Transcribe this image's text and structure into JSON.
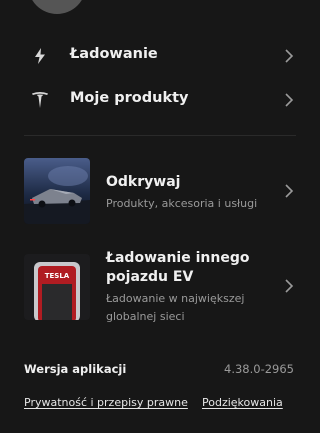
{
  "menu": {
    "charging": {
      "label": "Ładowanie",
      "icon": "bolt-icon"
    },
    "products": {
      "label": "Moje produkty",
      "icon": "tesla-logo-icon"
    }
  },
  "cards": {
    "discover": {
      "title": "Odkrywaj",
      "subtitle": "Produkty, akcesoria i usługi"
    },
    "other_ev": {
      "title_line1": "Ładowanie innego",
      "title_line2": "pojazdu EV",
      "subtitle_line1": "Ładowanie w największej",
      "subtitle_line2": "globalnej sieci",
      "thumb_brand": "TESLA"
    }
  },
  "footer": {
    "version_label": "Wersja aplikacji",
    "version_value": "4.38.0-2965",
    "privacy_link": "Prywatność i przepisy prawne",
    "thanks_link": "Podziękowania"
  }
}
